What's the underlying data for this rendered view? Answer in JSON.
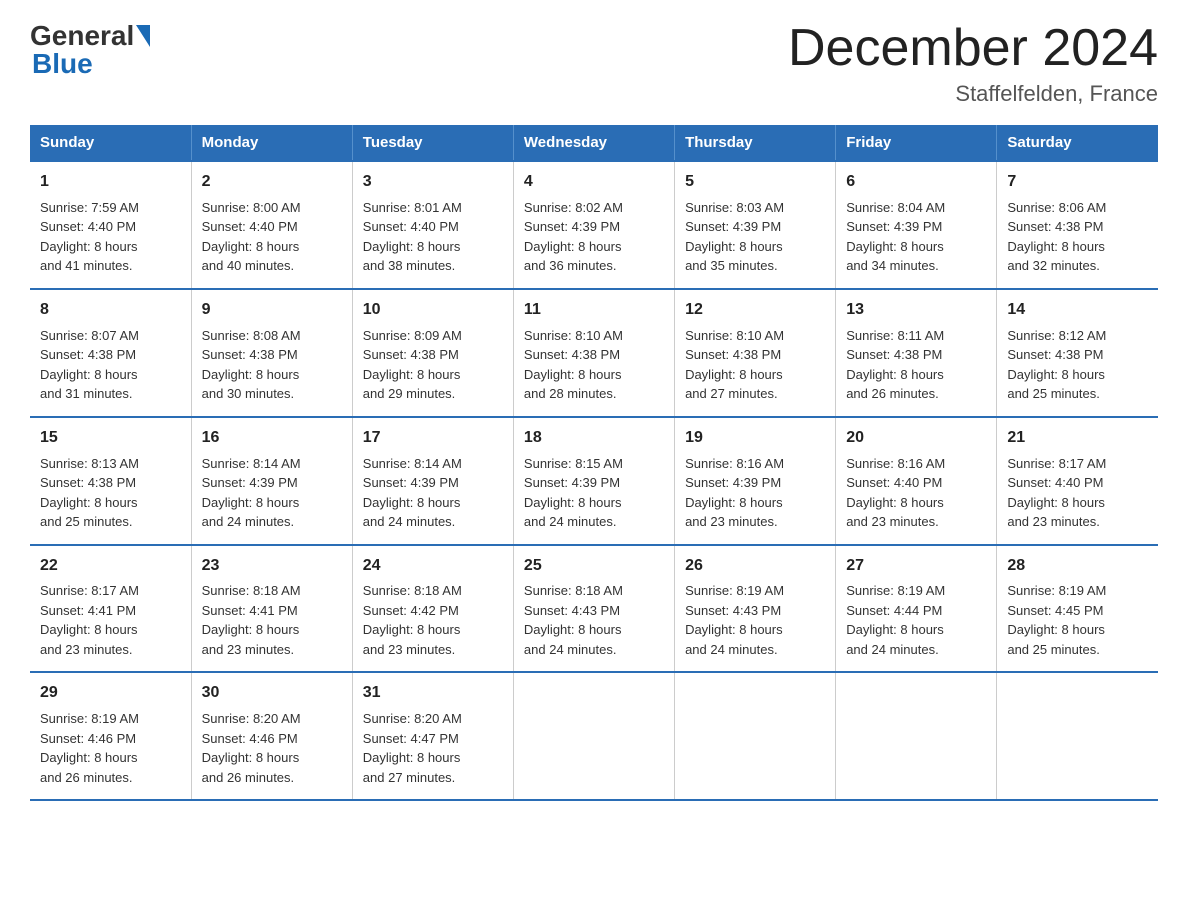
{
  "header": {
    "logo_general": "General",
    "logo_blue": "Blue",
    "month_year": "December 2024",
    "location": "Staffelfelden, France"
  },
  "days_of_week": [
    "Sunday",
    "Monday",
    "Tuesday",
    "Wednesday",
    "Thursday",
    "Friday",
    "Saturday"
  ],
  "weeks": [
    [
      {
        "day": "1",
        "sunrise": "7:59 AM",
        "sunset": "4:40 PM",
        "daylight": "8 hours and 41 minutes."
      },
      {
        "day": "2",
        "sunrise": "8:00 AM",
        "sunset": "4:40 PM",
        "daylight": "8 hours and 40 minutes."
      },
      {
        "day": "3",
        "sunrise": "8:01 AM",
        "sunset": "4:40 PM",
        "daylight": "8 hours and 38 minutes."
      },
      {
        "day": "4",
        "sunrise": "8:02 AM",
        "sunset": "4:39 PM",
        "daylight": "8 hours and 36 minutes."
      },
      {
        "day": "5",
        "sunrise": "8:03 AM",
        "sunset": "4:39 PM",
        "daylight": "8 hours and 35 minutes."
      },
      {
        "day": "6",
        "sunrise": "8:04 AM",
        "sunset": "4:39 PM",
        "daylight": "8 hours and 34 minutes."
      },
      {
        "day": "7",
        "sunrise": "8:06 AM",
        "sunset": "4:38 PM",
        "daylight": "8 hours and 32 minutes."
      }
    ],
    [
      {
        "day": "8",
        "sunrise": "8:07 AM",
        "sunset": "4:38 PM",
        "daylight": "8 hours and 31 minutes."
      },
      {
        "day": "9",
        "sunrise": "8:08 AM",
        "sunset": "4:38 PM",
        "daylight": "8 hours and 30 minutes."
      },
      {
        "day": "10",
        "sunrise": "8:09 AM",
        "sunset": "4:38 PM",
        "daylight": "8 hours and 29 minutes."
      },
      {
        "day": "11",
        "sunrise": "8:10 AM",
        "sunset": "4:38 PM",
        "daylight": "8 hours and 28 minutes."
      },
      {
        "day": "12",
        "sunrise": "8:10 AM",
        "sunset": "4:38 PM",
        "daylight": "8 hours and 27 minutes."
      },
      {
        "day": "13",
        "sunrise": "8:11 AM",
        "sunset": "4:38 PM",
        "daylight": "8 hours and 26 minutes."
      },
      {
        "day": "14",
        "sunrise": "8:12 AM",
        "sunset": "4:38 PM",
        "daylight": "8 hours and 25 minutes."
      }
    ],
    [
      {
        "day": "15",
        "sunrise": "8:13 AM",
        "sunset": "4:38 PM",
        "daylight": "8 hours and 25 minutes."
      },
      {
        "day": "16",
        "sunrise": "8:14 AM",
        "sunset": "4:39 PM",
        "daylight": "8 hours and 24 minutes."
      },
      {
        "day": "17",
        "sunrise": "8:14 AM",
        "sunset": "4:39 PM",
        "daylight": "8 hours and 24 minutes."
      },
      {
        "day": "18",
        "sunrise": "8:15 AM",
        "sunset": "4:39 PM",
        "daylight": "8 hours and 24 minutes."
      },
      {
        "day": "19",
        "sunrise": "8:16 AM",
        "sunset": "4:39 PM",
        "daylight": "8 hours and 23 minutes."
      },
      {
        "day": "20",
        "sunrise": "8:16 AM",
        "sunset": "4:40 PM",
        "daylight": "8 hours and 23 minutes."
      },
      {
        "day": "21",
        "sunrise": "8:17 AM",
        "sunset": "4:40 PM",
        "daylight": "8 hours and 23 minutes."
      }
    ],
    [
      {
        "day": "22",
        "sunrise": "8:17 AM",
        "sunset": "4:41 PM",
        "daylight": "8 hours and 23 minutes."
      },
      {
        "day": "23",
        "sunrise": "8:18 AM",
        "sunset": "4:41 PM",
        "daylight": "8 hours and 23 minutes."
      },
      {
        "day": "24",
        "sunrise": "8:18 AM",
        "sunset": "4:42 PM",
        "daylight": "8 hours and 23 minutes."
      },
      {
        "day": "25",
        "sunrise": "8:18 AM",
        "sunset": "4:43 PM",
        "daylight": "8 hours and 24 minutes."
      },
      {
        "day": "26",
        "sunrise": "8:19 AM",
        "sunset": "4:43 PM",
        "daylight": "8 hours and 24 minutes."
      },
      {
        "day": "27",
        "sunrise": "8:19 AM",
        "sunset": "4:44 PM",
        "daylight": "8 hours and 24 minutes."
      },
      {
        "day": "28",
        "sunrise": "8:19 AM",
        "sunset": "4:45 PM",
        "daylight": "8 hours and 25 minutes."
      }
    ],
    [
      {
        "day": "29",
        "sunrise": "8:19 AM",
        "sunset": "4:46 PM",
        "daylight": "8 hours and 26 minutes."
      },
      {
        "day": "30",
        "sunrise": "8:20 AM",
        "sunset": "4:46 PM",
        "daylight": "8 hours and 26 minutes."
      },
      {
        "day": "31",
        "sunrise": "8:20 AM",
        "sunset": "4:47 PM",
        "daylight": "8 hours and 27 minutes."
      },
      {
        "day": "",
        "sunrise": "",
        "sunset": "",
        "daylight": ""
      },
      {
        "day": "",
        "sunrise": "",
        "sunset": "",
        "daylight": ""
      },
      {
        "day": "",
        "sunrise": "",
        "sunset": "",
        "daylight": ""
      },
      {
        "day": "",
        "sunrise": "",
        "sunset": "",
        "daylight": ""
      }
    ]
  ],
  "labels": {
    "sunrise": "Sunrise: ",
    "sunset": "Sunset: ",
    "daylight": "Daylight: "
  }
}
